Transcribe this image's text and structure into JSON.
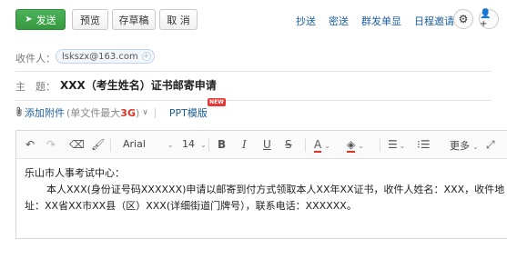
{
  "toolbar": {
    "send_label": "发送",
    "preview_label": "预览",
    "draft_label": "存草稿",
    "cancel_label": "取 消"
  },
  "toplinks": [
    "抄送",
    "密送",
    "群发单显",
    "日程邀请"
  ],
  "recipient": {
    "label": "收件人：",
    "email": "lskszx@163.com",
    "add_symbol": "+"
  },
  "subject": {
    "label": "主　题：",
    "value": "XXX（考生姓名）证书邮寄申请"
  },
  "attach": {
    "link": "添加附件",
    "note_prefix": "(单文件最大",
    "note_size": "3G",
    "note_suffix": ")",
    "ppt_label": "PPT模版",
    "new_badge": "NEW"
  },
  "editor_toolbar": {
    "font": "Arial",
    "size": "14",
    "more_label": "更多"
  },
  "body": {
    "greeting": "乐山市人事考试中心：",
    "line1": "本人XXX(身份证号码XXXXXX)申请以邮寄到付方式领取本人XX年XX证书，收件人姓名：XXX，收件地",
    "line2": "址：XX省XX市XX县（区）XXX(详细街道门牌号），联系电话：XXXXXX。"
  },
  "colors": {
    "send_green": "#3fa64a",
    "link_blue": "#1d5d9b",
    "badge_red": "#e53935"
  }
}
